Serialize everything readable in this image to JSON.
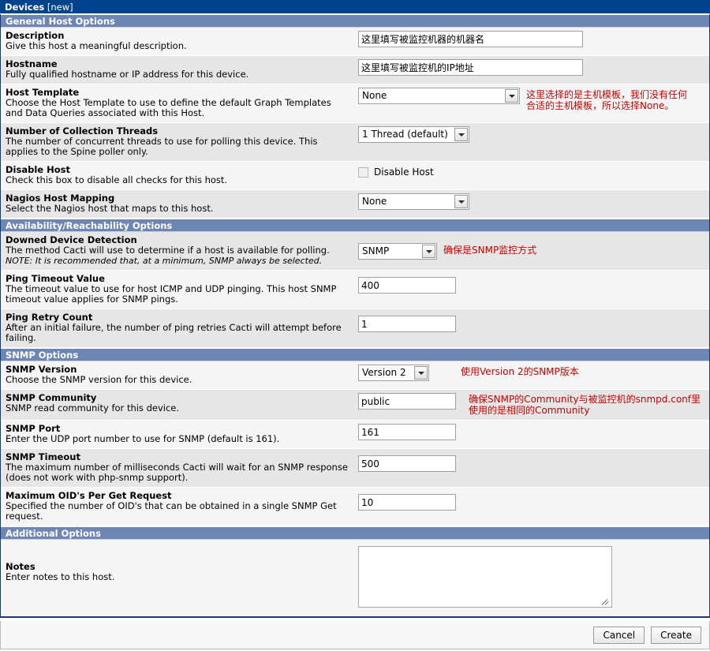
{
  "header": {
    "title": "Devices",
    "mode": "[new]"
  },
  "colors": {
    "title_bar": "#00438c",
    "section_head": "#6d86b4",
    "annotation": "#cc0000",
    "row_alt": "#e6e6e6",
    "row_base": "#f5f5f5"
  },
  "sections": [
    {
      "id": "general",
      "label": "General Host Options"
    },
    {
      "id": "availability",
      "label": "Availability/Reachability Options"
    },
    {
      "id": "snmp",
      "label": "SNMP Options"
    },
    {
      "id": "additional",
      "label": "Additional Options"
    }
  ],
  "fields": {
    "description": {
      "name": "Description",
      "desc": "Give this host a meaningful description.",
      "value": "这里填写被监控机器的机器名"
    },
    "hostname": {
      "name": "Hostname",
      "desc": "Fully qualified hostname or IP address for this device.",
      "value": "这里填写被监控机的IP地址"
    },
    "host_template": {
      "name": "Host Template",
      "desc": "Choose the Host Template to use to define the default Graph Templates and Data Queries associated with this Host.",
      "value": "None",
      "annotation": "这里选择的是主机模板，我们没有任何\n合适的主机模板，所以选择None。"
    },
    "collection_threads": {
      "name": "Number of Collection Threads",
      "desc": "The number of concurrent threads to use for polling this device. This applies to the Spine poller only.",
      "value": "1 Thread (default)"
    },
    "disable_host": {
      "name": "Disable Host",
      "desc": "Check this box to disable all checks for this host.",
      "checkbox_label": "Disable Host",
      "checked": false
    },
    "nagios_host_mapping": {
      "name": "Nagios Host Mapping",
      "desc": "Select the Nagios host that maps to this host.",
      "value": "None"
    },
    "downed_device_detection": {
      "name": "Downed Device Detection",
      "desc": "The method Cacti will use to determine if a host is available for polling.",
      "note": "NOTE: It is recommended that, at a minimum, SNMP always be selected.",
      "value": "SNMP",
      "annotation": "确保是SNMP监控方式"
    },
    "ping_timeout": {
      "name": "Ping Timeout Value",
      "desc": "The timeout value to use for host ICMP and UDP pinging. This host SNMP timeout value applies for SNMP pings.",
      "value": "400"
    },
    "ping_retry_count": {
      "name": "Ping Retry Count",
      "desc": "After an initial failure, the number of ping retries Cacti will attempt before failing.",
      "value": "1"
    },
    "snmp_version": {
      "name": "SNMP Version",
      "desc": "Choose the SNMP version for this device.",
      "value": "Version 2",
      "annotation": "使用Version 2的SNMP版本"
    },
    "snmp_community": {
      "name": "SNMP Community",
      "desc": "SNMP read community for this device.",
      "value": "public",
      "annotation": "确保SNMP的Community与被监控机的snmpd.conf里\n使用的是相同的Community"
    },
    "snmp_port": {
      "name": "SNMP Port",
      "desc": "Enter the UDP port number to use for SNMP (default is 161).",
      "value": "161"
    },
    "snmp_timeout": {
      "name": "SNMP Timeout",
      "desc": "The maximum number of milliseconds Cacti will wait for an SNMP response (does not work with php-snmp support).",
      "value": "500"
    },
    "max_oids": {
      "name": "Maximum OID's Per Get Request",
      "desc": "Specified the number of OID's that can be obtained in a single SNMP Get request.",
      "value": "10"
    },
    "notes": {
      "name": "Notes",
      "desc": "Enter notes to this host.",
      "value": ""
    }
  },
  "footer": {
    "cancel_label": "Cancel",
    "create_label": "Create"
  }
}
